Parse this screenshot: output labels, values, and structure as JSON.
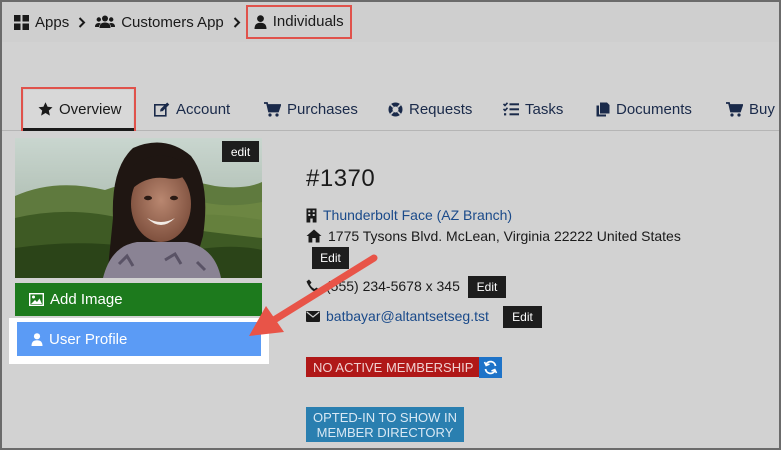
{
  "breadcrumb": {
    "apps": "Apps",
    "customers_app": "Customers App",
    "individuals": "Individuals"
  },
  "tabs": [
    {
      "label": "Overview",
      "icon": "star-icon",
      "active": true
    },
    {
      "label": "Account",
      "icon": "edit-icon"
    },
    {
      "label": "Purchases",
      "icon": "cart-icon"
    },
    {
      "label": "Requests",
      "icon": "support-icon"
    },
    {
      "label": "Tasks",
      "icon": "tasks-icon"
    },
    {
      "label": "Documents",
      "icon": "documents-icon"
    },
    {
      "label": "Buy",
      "icon": "cart-icon"
    }
  ],
  "profile": {
    "photo_edit": "edit",
    "add_image": "Add Image",
    "user_profile": "User Profile"
  },
  "record": {
    "id": "#1370",
    "organization": "Thunderbolt Face (AZ Branch)",
    "address": "1775 Tysons Blvd. McLean, Virginia 22222 United States",
    "address_edit": "Edit",
    "phone": "(555) 234-5678 x 345",
    "phone_edit": "Edit",
    "email": "batbayar@altantsetseg.tst",
    "email_edit": "Edit",
    "membership": "NO ACTIVE MEMBERSHIP",
    "directory_line1": "OPTED-IN TO SHOW IN",
    "directory_line2": "MEMBER DIRECTORY"
  },
  "colors": {
    "highlight": "#e0524b",
    "add_image": "#1d7a1d",
    "user_profile": "#5b9bf5",
    "membership": "#b01818",
    "directory": "#2a7fb0",
    "link": "#1a4a8a"
  }
}
